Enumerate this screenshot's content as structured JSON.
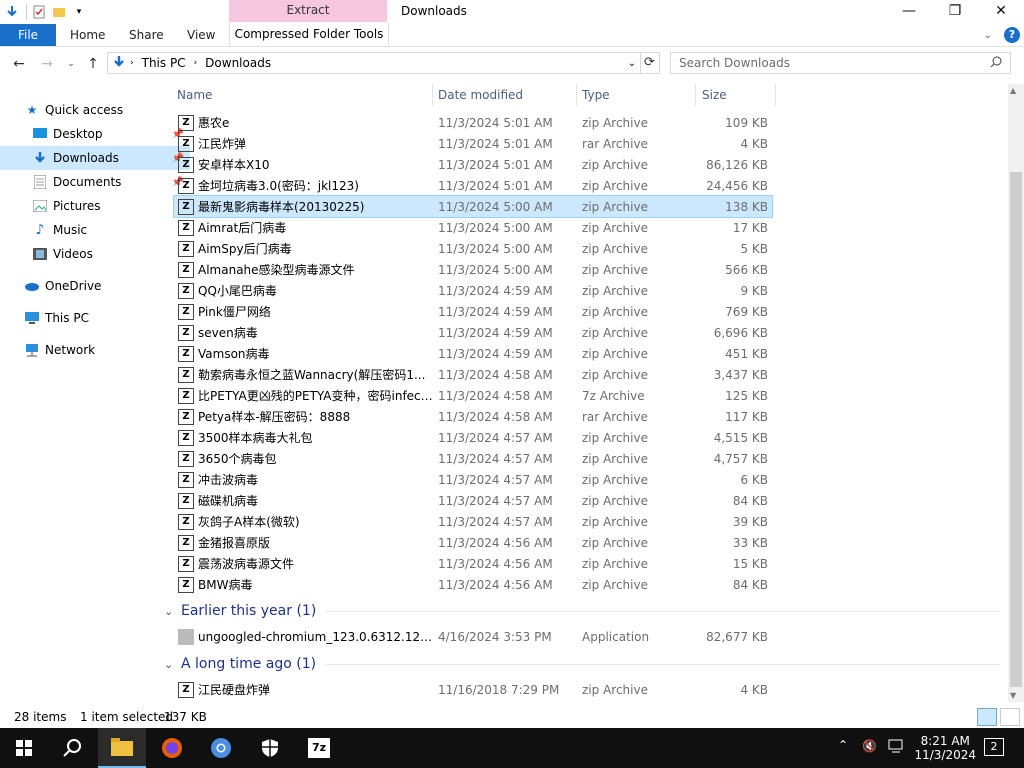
{
  "window": {
    "title": "Downloads",
    "contextual_tab": "Extract",
    "minimize": "—",
    "maximize": "❐",
    "close": "✕"
  },
  "ribbon": {
    "tabs": [
      "File",
      "Home",
      "Share",
      "View",
      "Compressed Folder Tools"
    ],
    "help": "?"
  },
  "address": {
    "segments": [
      "This PC",
      "Downloads"
    ],
    "search_placeholder": "Search Downloads"
  },
  "nav_pane": {
    "items": [
      {
        "label": "Quick access",
        "icon": "star-icon"
      },
      {
        "label": "Desktop",
        "icon": "desktop-icon",
        "pinned": true
      },
      {
        "label": "Downloads",
        "icon": "download-arrow-icon",
        "pinned": true,
        "selected": true
      },
      {
        "label": "Documents",
        "icon": "documents-icon",
        "pinned": true
      },
      {
        "label": "Pictures",
        "icon": "pictures-icon",
        "pinned": true
      },
      {
        "label": "Music",
        "icon": "music-icon"
      },
      {
        "label": "Videos",
        "icon": "videos-icon"
      },
      {
        "label": "OneDrive",
        "icon": "cloud-icon"
      },
      {
        "label": "This PC",
        "icon": "computer-icon"
      },
      {
        "label": "Network",
        "icon": "network-icon"
      }
    ]
  },
  "columns": {
    "name": "Name",
    "date": "Date modified",
    "type": "Type",
    "size": "Size"
  },
  "files": [
    {
      "name": "惠农e",
      "date": "11/3/2024 5:01 AM",
      "type": "zip Archive",
      "size": "109 KB"
    },
    {
      "name": "江民炸弹",
      "date": "11/3/2024 5:01 AM",
      "type": "rar Archive",
      "size": "4 KB"
    },
    {
      "name": "安卓样本X10",
      "date": "11/3/2024 5:01 AM",
      "type": "zip Archive",
      "size": "86,126 KB"
    },
    {
      "name": "金坷垃病毒3.0(密码：jkl123)",
      "date": "11/3/2024 5:01 AM",
      "type": "zip Archive",
      "size": "24,456 KB"
    },
    {
      "name": "最新鬼影病毒样本(20130225)",
      "date": "11/3/2024 5:00 AM",
      "type": "zip Archive",
      "size": "138 KB",
      "selected": true
    },
    {
      "name": "Aimrat后门病毒",
      "date": "11/3/2024 5:00 AM",
      "type": "zip Archive",
      "size": "17 KB"
    },
    {
      "name": "AimSpy后门病毒",
      "date": "11/3/2024 5:00 AM",
      "type": "zip Archive",
      "size": "5 KB"
    },
    {
      "name": "Almanahe感染型病毒源文件",
      "date": "11/3/2024 5:00 AM",
      "type": "zip Archive",
      "size": "566 KB"
    },
    {
      "name": "QQ小尾巴病毒",
      "date": "11/3/2024 4:59 AM",
      "type": "zip Archive",
      "size": "9 KB"
    },
    {
      "name": "Pink僵尸网络",
      "date": "11/3/2024 4:59 AM",
      "type": "zip Archive",
      "size": "769 KB"
    },
    {
      "name": "seven病毒",
      "date": "11/3/2024 4:59 AM",
      "type": "zip Archive",
      "size": "6,696 KB"
    },
    {
      "name": "Vamson病毒",
      "date": "11/3/2024 4:59 AM",
      "type": "zip Archive",
      "size": "451 KB"
    },
    {
      "name": "勒索病毒永恒之蓝Wannacry(解压密码1...",
      "date": "11/3/2024 4:58 AM",
      "type": "zip Archive",
      "size": "3,437 KB"
    },
    {
      "name": "比PETYA更凶残的PETYA变种，密码infect...",
      "date": "11/3/2024 4:58 AM",
      "type": "7z Archive",
      "size": "125 KB"
    },
    {
      "name": "Petya样本-解压密码：8888",
      "date": "11/3/2024 4:58 AM",
      "type": "rar Archive",
      "size": "117 KB"
    },
    {
      "name": "3500样本病毒大礼包",
      "date": "11/3/2024 4:57 AM",
      "type": "zip Archive",
      "size": "4,515 KB"
    },
    {
      "name": "3650个病毒包",
      "date": "11/3/2024 4:57 AM",
      "type": "zip Archive",
      "size": "4,757 KB"
    },
    {
      "name": "冲击波病毒",
      "date": "11/3/2024 4:57 AM",
      "type": "zip Archive",
      "size": "6 KB"
    },
    {
      "name": "磁碟机病毒",
      "date": "11/3/2024 4:57 AM",
      "type": "zip Archive",
      "size": "84 KB"
    },
    {
      "name": "灰鸽子A样本(微软)",
      "date": "11/3/2024 4:57 AM",
      "type": "zip Archive",
      "size": "39 KB"
    },
    {
      "name": "金猪报喜原版",
      "date": "11/3/2024 4:56 AM",
      "type": "zip Archive",
      "size": "33 KB"
    },
    {
      "name": "震荡波病毒源文件",
      "date": "11/3/2024 4:56 AM",
      "type": "zip Archive",
      "size": "15 KB"
    },
    {
      "name": "BMW病毒",
      "date": "11/3/2024 4:56 AM",
      "type": "zip Archive",
      "size": "84 KB"
    }
  ],
  "groups": [
    {
      "title": "Earlier this year (1)",
      "files": [
        {
          "name": "ungoogled-chromium_123.0.6312.122-1....",
          "date": "4/16/2024 3:53 PM",
          "type": "Application",
          "size": "82,677 KB",
          "icon": "installer-icon"
        }
      ]
    },
    {
      "title": "A long time ago (1)",
      "files": [
        {
          "name": "江民硬盘炸弹",
          "date": "11/16/2018 7:29 PM",
          "type": "zip Archive",
          "size": "4 KB"
        }
      ]
    }
  ],
  "status": {
    "item_count": "28 items",
    "selection": "1 item selected",
    "selection_size": "137 KB"
  },
  "taskbar": {
    "time": "8:21 AM",
    "date": "11/3/2024",
    "notification_count": "2",
    "apps": [
      "start-icon",
      "search-icon",
      "file-explorer-icon",
      "firefox-icon",
      "chromium-icon",
      "security-icon",
      "7zip-icon"
    ]
  },
  "colors": {
    "accent": "#1a6fc9",
    "selection": "#cce8ff",
    "contextual_tab": "#f7c6df",
    "taskbar": "#101010"
  }
}
